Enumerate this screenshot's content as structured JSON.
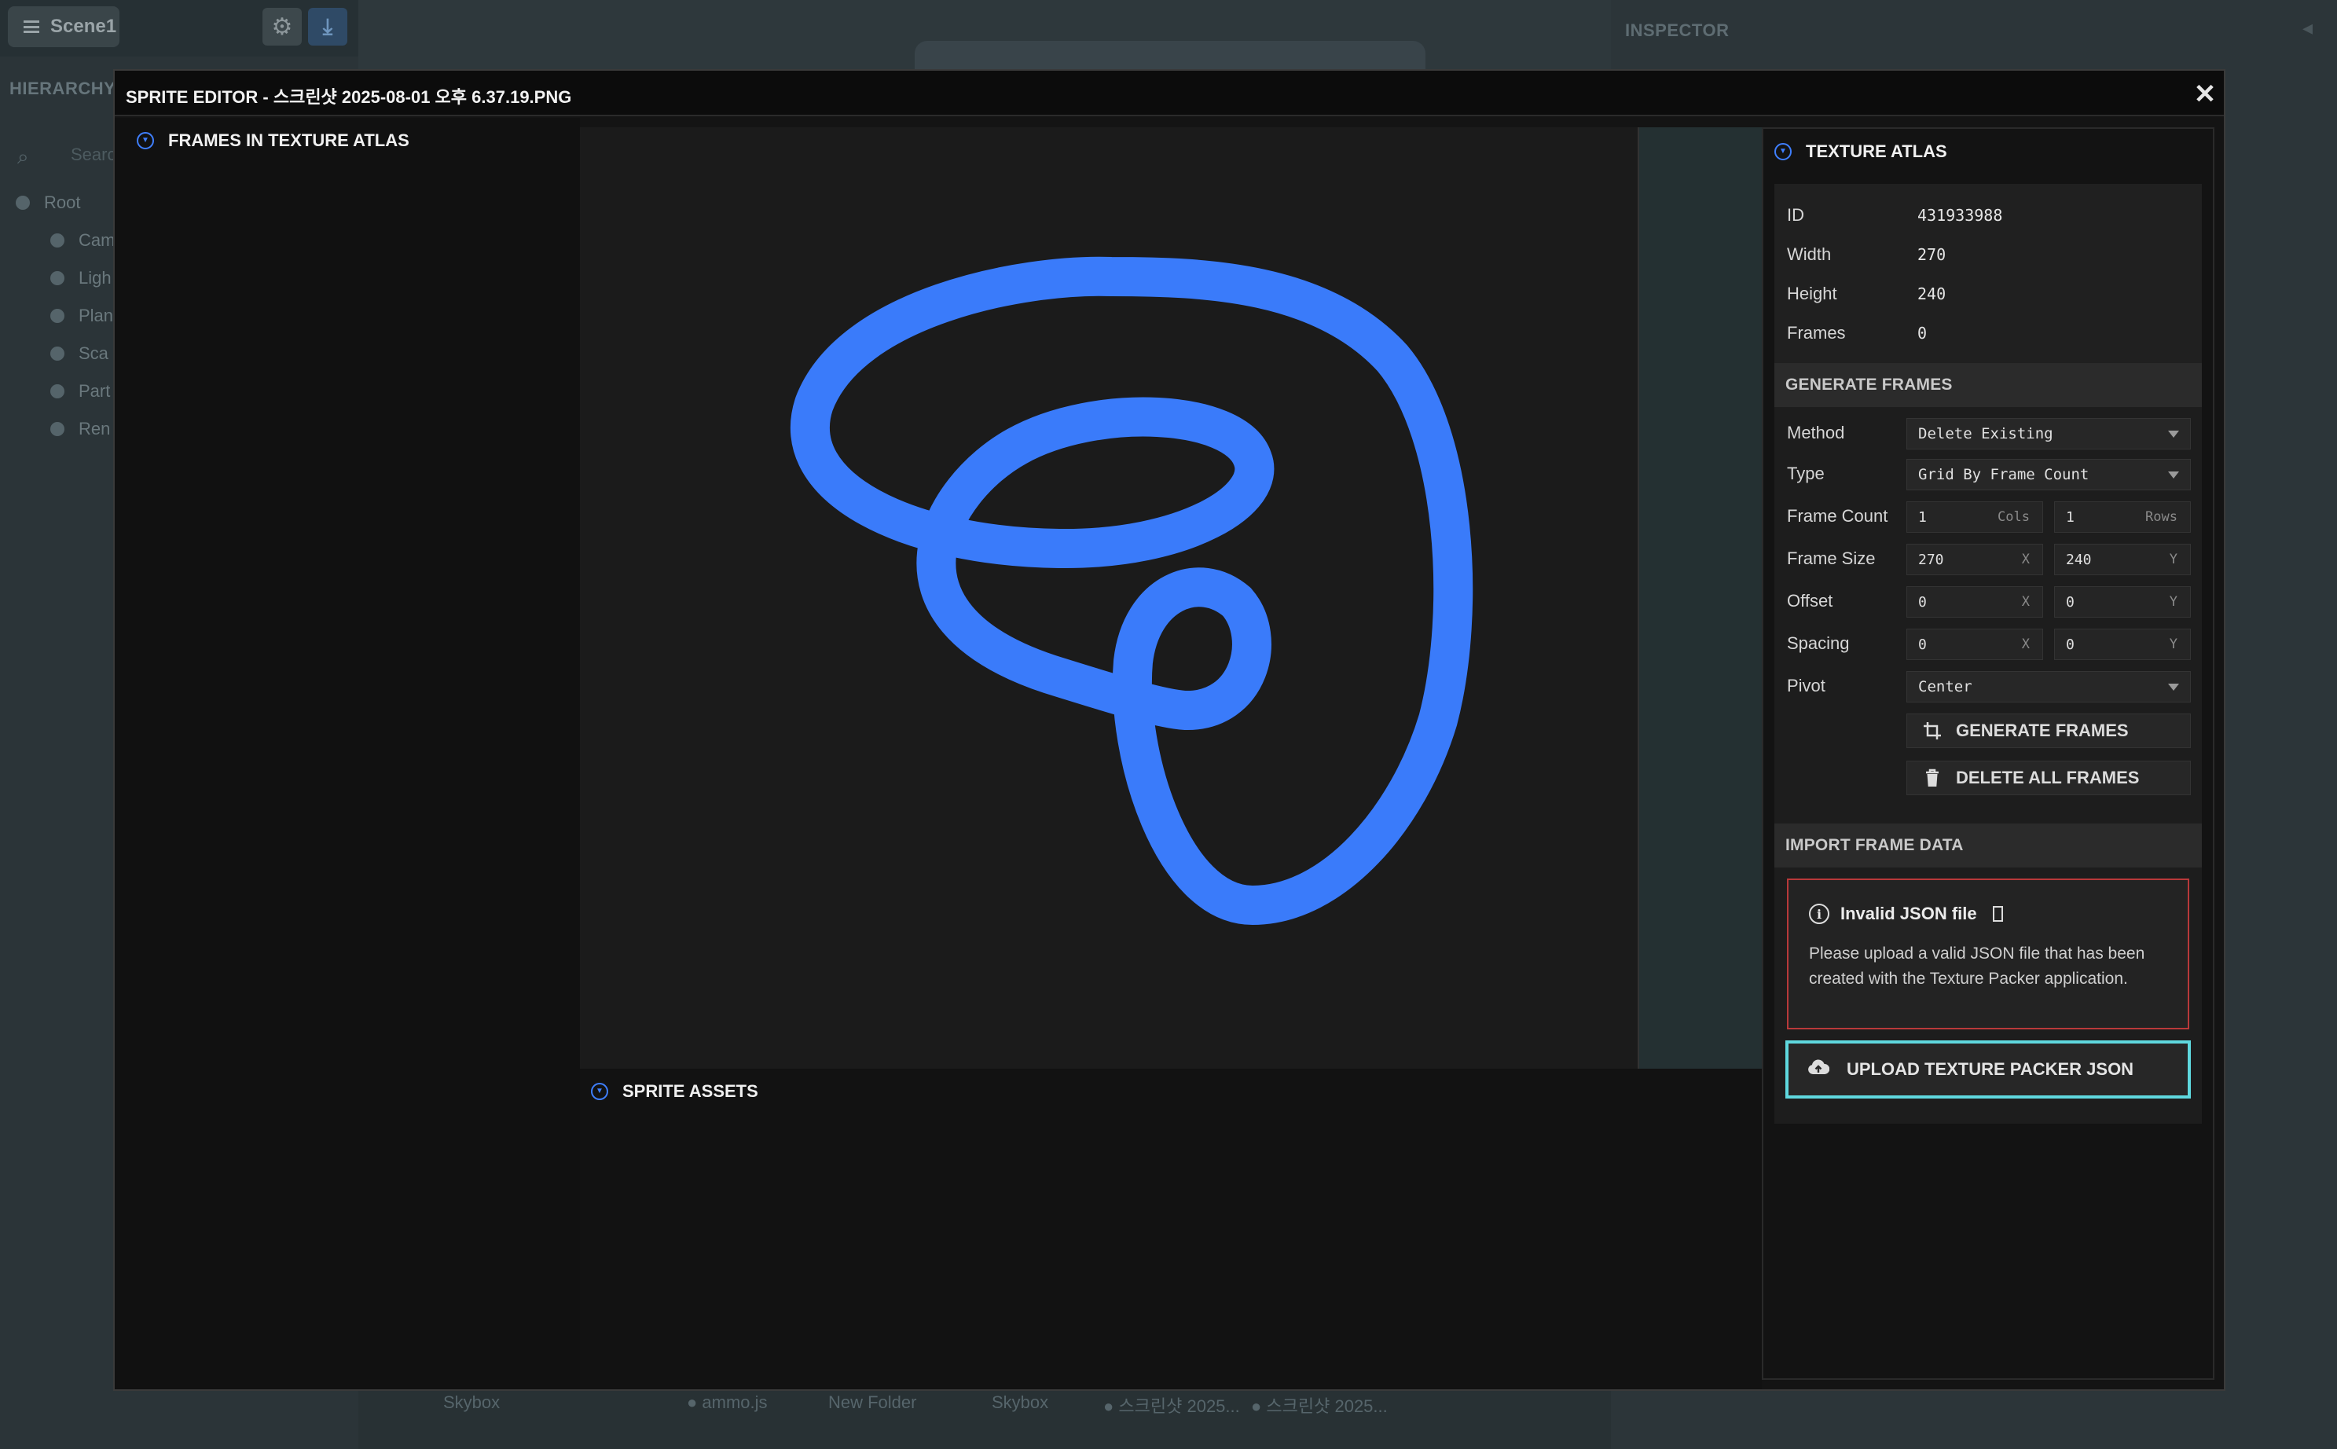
{
  "background": {
    "scene_button": "Scene1",
    "hierarchy_title": "HIERARCHY",
    "search_placeholder": "Search",
    "hierarchy_items": [
      "Root",
      "Cam",
      "Ligh",
      "Plan",
      "Sca",
      "Part",
      "Ren"
    ],
    "inspector_title": "INSPECTOR",
    "asset_items": [
      "Skybox",
      "● ammo.js",
      "New Folder",
      "Skybox",
      "● 스크린샷 2025...",
      "● 스크린샷 2025..."
    ]
  },
  "modal": {
    "title": "SPRITE EDITOR - 스크린샷 2025-08-01 오후 6.37.19.PNG",
    "close_glyph": "✕"
  },
  "frames_panel": {
    "title": "FRAMES IN TEXTURE ATLAS"
  },
  "sprite_assets": {
    "title": "SPRITE ASSETS"
  },
  "texture_atlas": {
    "title": "TEXTURE ATLAS",
    "info": {
      "id_label": "ID",
      "id_value": "431933988",
      "width_label": "Width",
      "width_value": "270",
      "height_label": "Height",
      "height_value": "240",
      "frames_label": "Frames",
      "frames_value": "0"
    },
    "generate": {
      "heading": "GENERATE FRAMES",
      "method_label": "Method",
      "method_value": "Delete Existing",
      "type_label": "Type",
      "type_value": "Grid By Frame Count",
      "frame_count_label": "Frame Count",
      "cols_value": "1",
      "cols_suffix": "Cols",
      "rows_value": "1",
      "rows_suffix": "Rows",
      "frame_size_label": "Frame Size",
      "size_x": "270",
      "size_y": "240",
      "offset_label": "Offset",
      "offset_x": "0",
      "offset_y": "0",
      "spacing_label": "Spacing",
      "spacing_x": "0",
      "spacing_y": "0",
      "x_suffix": "X",
      "y_suffix": "Y",
      "pivot_label": "Pivot",
      "pivot_value": "Center",
      "generate_button": "GENERATE FRAMES",
      "delete_button": "DELETE ALL FRAMES"
    },
    "import": {
      "heading": "IMPORT FRAME DATA",
      "error_title": "Invalid JSON file",
      "error_message": "Please upload a valid JSON file that has been created with the Texture Packer application.",
      "upload_button": "UPLOAD TEXTURE PACKER JSON"
    }
  },
  "colors": {
    "accent": "#3f7fff",
    "sprite_stroke": "#3a7bfa",
    "error_border": "#b8393a",
    "focus_border": "#5fd8de"
  }
}
